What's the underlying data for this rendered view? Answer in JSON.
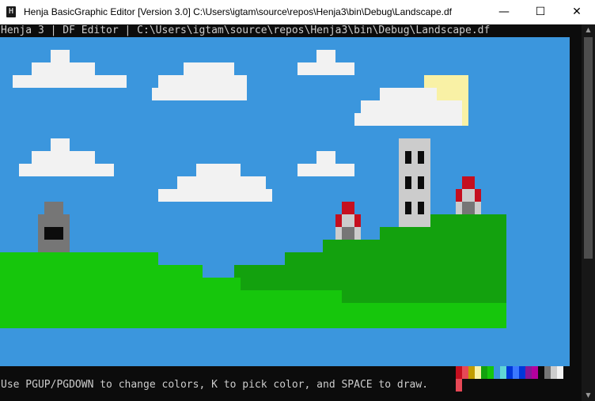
{
  "window": {
    "title": "Henja BasicGraphic Editor [Version 3.0] C:\\Users\\igtam\\source\\repos\\Henja3\\bin\\Debug\\Landscape.df",
    "icon_glyph": "H",
    "minimize_glyph": "—",
    "maximize_glyph": "☐",
    "close_glyph": "✕"
  },
  "console": {
    "header": "Henja 3 | DF Editor | C:\\Users\\igtam\\source\\repos\\Henja3\\bin\\Debug\\Landscape.df",
    "status": "Use PGUP/PGDOWN to change colors, K to pick color, and SPACE to draw."
  },
  "palette": {
    "colors": [
      "#c50f1f",
      "#e74856",
      "#c19c00",
      "#f9f1a5",
      "#13a10e",
      "#16c60c",
      "#3a96dd",
      "#61d6d6",
      "#0037da",
      "#3b78ff",
      "#0037da",
      "#881798",
      "#b4009e",
      "#0c0c0c",
      "#767676",
      "#cccccc",
      "#f2f2f2",
      "#0c0c0c"
    ],
    "selected_index": 1
  },
  "scene": {
    "sky_color": "#3b96dd",
    "objects": [
      "clouds",
      "sun",
      "hills",
      "tower",
      "stone hut",
      "red houses"
    ]
  }
}
